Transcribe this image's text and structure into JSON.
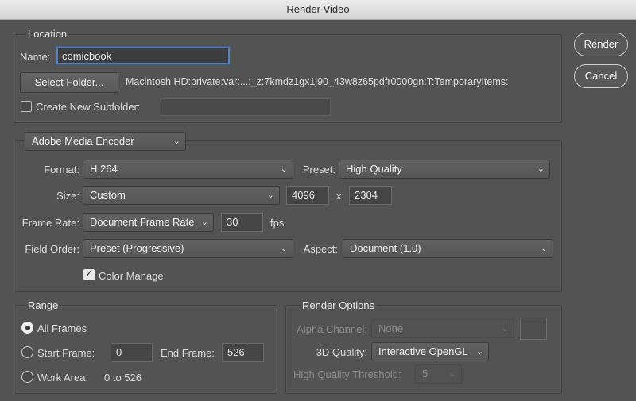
{
  "window": {
    "title": "Render Video"
  },
  "actions": {
    "render": "Render",
    "cancel": "Cancel"
  },
  "location": {
    "legend": "Location",
    "name_label": "Name:",
    "name_value": "comicbook",
    "select_folder": "Select Folder...",
    "path": "Macintosh HD:private:var:...:_z:7kmdz1gx1j90_43w8z65pdfr0000gn:T:TemporaryItems:",
    "create_subfolder_label": "Create New Subfolder:",
    "create_subfolder_checked": false,
    "subfolder_value": ""
  },
  "encoder": {
    "selected": "Adobe Media Encoder",
    "format_label": "Format:",
    "format": "H.264",
    "preset_label": "Preset:",
    "preset": "High Quality",
    "size_label": "Size:",
    "size": "Custom",
    "width": "4096",
    "times": "x",
    "height": "2304",
    "frame_rate_label": "Frame Rate:",
    "frame_rate": "Document Frame Rate",
    "fps_value": "30",
    "fps_unit": "fps",
    "field_order_label": "Field Order:",
    "field_order": "Preset (Progressive)",
    "aspect_label": "Aspect:",
    "aspect": "Document (1.0)",
    "color_manage_label": "Color Manage",
    "color_manage_checked": true
  },
  "range": {
    "legend": "Range",
    "all_frames": "All Frames",
    "start_frame_label": "Start Frame:",
    "start_frame": "0",
    "end_frame_label": "End Frame:",
    "end_frame": "526",
    "work_area_label": "Work Area:",
    "work_area_value": "0 to 526",
    "selected": "all_frames"
  },
  "render_options": {
    "legend": "Render Options",
    "alpha_channel_label": "Alpha Channel:",
    "alpha_channel": "None",
    "quality_label": "3D Quality:",
    "quality": "Interactive OpenGL",
    "threshold_label": "High Quality Threshold:",
    "threshold": "5"
  }
}
